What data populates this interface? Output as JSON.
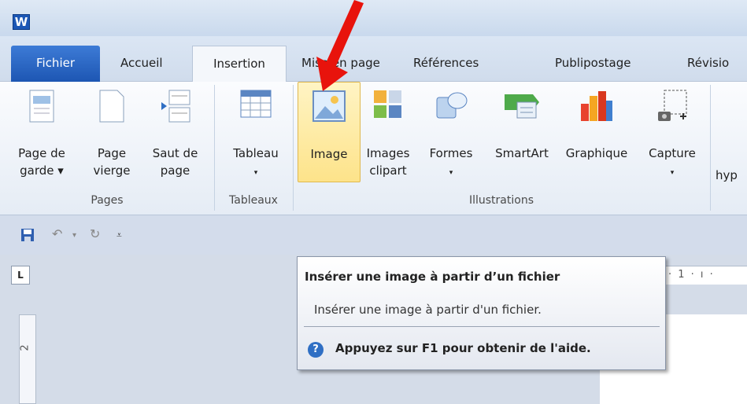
{
  "app": {
    "icon_letter": "W"
  },
  "tabs": [
    {
      "label": "Fichier"
    },
    {
      "label": "Accueil"
    },
    {
      "label": "Insertion"
    },
    {
      "label": "Mise en page"
    },
    {
      "label": "Références"
    },
    {
      "label": "Publipostage"
    },
    {
      "label": "Révisio"
    }
  ],
  "ribbon": {
    "groups": {
      "pages": "Pages",
      "tableaux": "Tableaux",
      "illustrations": "Illustrations"
    },
    "buttons": {
      "page_de_garde": [
        "Page de",
        "garde ▾"
      ],
      "page_vierge": [
        "Page",
        "vierge"
      ],
      "saut_de_page": [
        "Saut de",
        "page"
      ],
      "tableau": [
        "Tableau",
        "▾"
      ],
      "image": [
        "Image"
      ],
      "images_clipart": [
        "Images",
        "clipart"
      ],
      "formes": [
        "Formes",
        "▾"
      ],
      "smartart": [
        "SmartArt"
      ],
      "graphique": [
        "Graphique"
      ],
      "capture": [
        "Capture",
        "▾"
      ],
      "hyp": [
        "hyp"
      ]
    }
  },
  "ruler": {
    "vertical_mark": "2",
    "horizontal_text": "· 1 · ı ·",
    "corner": "L"
  },
  "tooltip": {
    "title": "Insérer une image à partir d’un fichier",
    "body": "Insérer une image à partir d'un fichier.",
    "help_icon": "?",
    "help": "Appuyez sur F1 pour obtenir de l'aide."
  },
  "colors": {
    "accent_file": "#2a63c0",
    "highlight": "#fde38a",
    "arrow": "#e8130c"
  }
}
